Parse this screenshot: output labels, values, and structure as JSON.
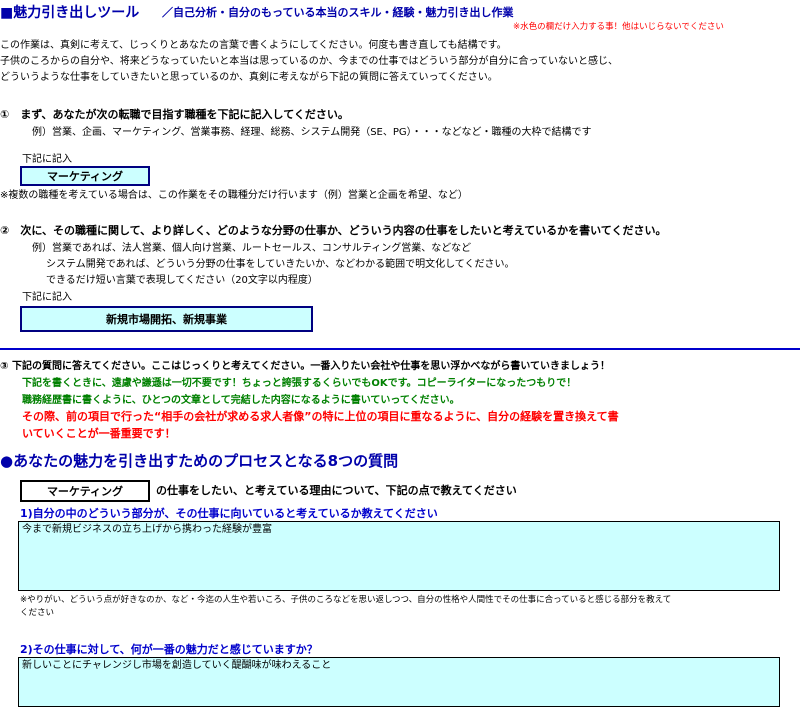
{
  "header": {
    "title": "■魅力引き出しツール",
    "subtitle": "／自己分析・自分のもっている本当のスキル・経験・魅力引き出し作業",
    "note": "※水色の欄だけ入力する事！他はいじらないでください"
  },
  "intro": {
    "line1": "この作業は、真剣に考えて、じっくりとあなたの言葉で書くようにしてください。何度も書き直しても結構です。",
    "line2": "子供のころからの自分や、将来どうなっていたいと本当は思っているのか、今までの仕事ではどういう部分が自分に合っていないと感じ、",
    "line3": "どういうような仕事をしていきたいと思っているのか、真剣に考えながら下記の質問に答えていってください。"
  },
  "step1": {
    "heading": "①　まず、あなたが次の転職で目指す職種を下記に記入してください。",
    "example": "例）営業、企画、マーケティング、営業事務、経理、総務、システム開発（SE、PG）・・・などなど・職種の大枠で結構です",
    "fill_label": "下記に記入",
    "value": "マーケティング",
    "note": "※複数の職種を考えている場合は、この作業をその職種分だけ行います（例）営業と企画を希望、など）"
  },
  "step2": {
    "heading": "②　次に、その職種に関して、より詳しく、どのような分野の仕事か、どういう内容の仕事をしたいと考えているかを書いてください。",
    "example1": "例）営業であれば、法人営業、個人向け営業、ルートセールス、コンサルティング営業、などなど",
    "example2": "システム開発であれば、どういう分野の仕事をしていきたいか、などわかる範囲で明文化してください。",
    "example3": "できるだけ短い言葉で表現してください（20文字以内程度）",
    "fill_label": "下記に記入",
    "value": "新規市場開拓、新規事業"
  },
  "step3": {
    "line1": "③ 下記の質問に答えてください。ここはじっくりと考えてください。一番入りたい会社や仕事を思い浮かべながら書いていきましょう！",
    "line2": "下記を書くときに、遠慮や謙遜は一切不要です！ちょっと誇張するくらいでもOKです。コピーライターになったつもりで！",
    "line3": "職務経歴書に書くように、ひとつの文章として完結した内容になるように書いていってください。",
    "line4": "その際、前の項目で行った“相手の会社が求める求人者像”の特に上位の項目に重なるように、自分の経験を置き換えて書",
    "line5": "いていくことが一番重要です！"
  },
  "section": {
    "title": "●あなたの魅力を引き出すためのプロセスとなる8つの質問",
    "job_value": "マーケティング",
    "job_suffix": "の仕事をしたい、と考えている理由について、下記の点で教えてください"
  },
  "questions": [
    {
      "label": "1)自分の中のどういう部分が、その仕事に向いていると考えているか教えてください",
      "answer": "今まで新規ビジネスの立ち上げから携わった経験が豊富",
      "hint1": "※やりがい、どういう点が好きなのか、など・今迄の人生や若いころ、子供のころなどを思い返しつつ、自分の性格や人間性でその仕事に合っていると感じる部分を教えて",
      "hint2": "ください"
    },
    {
      "label": "2)その仕事に対して、何が一番の魅力だと感じていますか？",
      "answer": "新しいことにチャレンジし市場を創造していく醍醐味が味わえること"
    }
  ]
}
